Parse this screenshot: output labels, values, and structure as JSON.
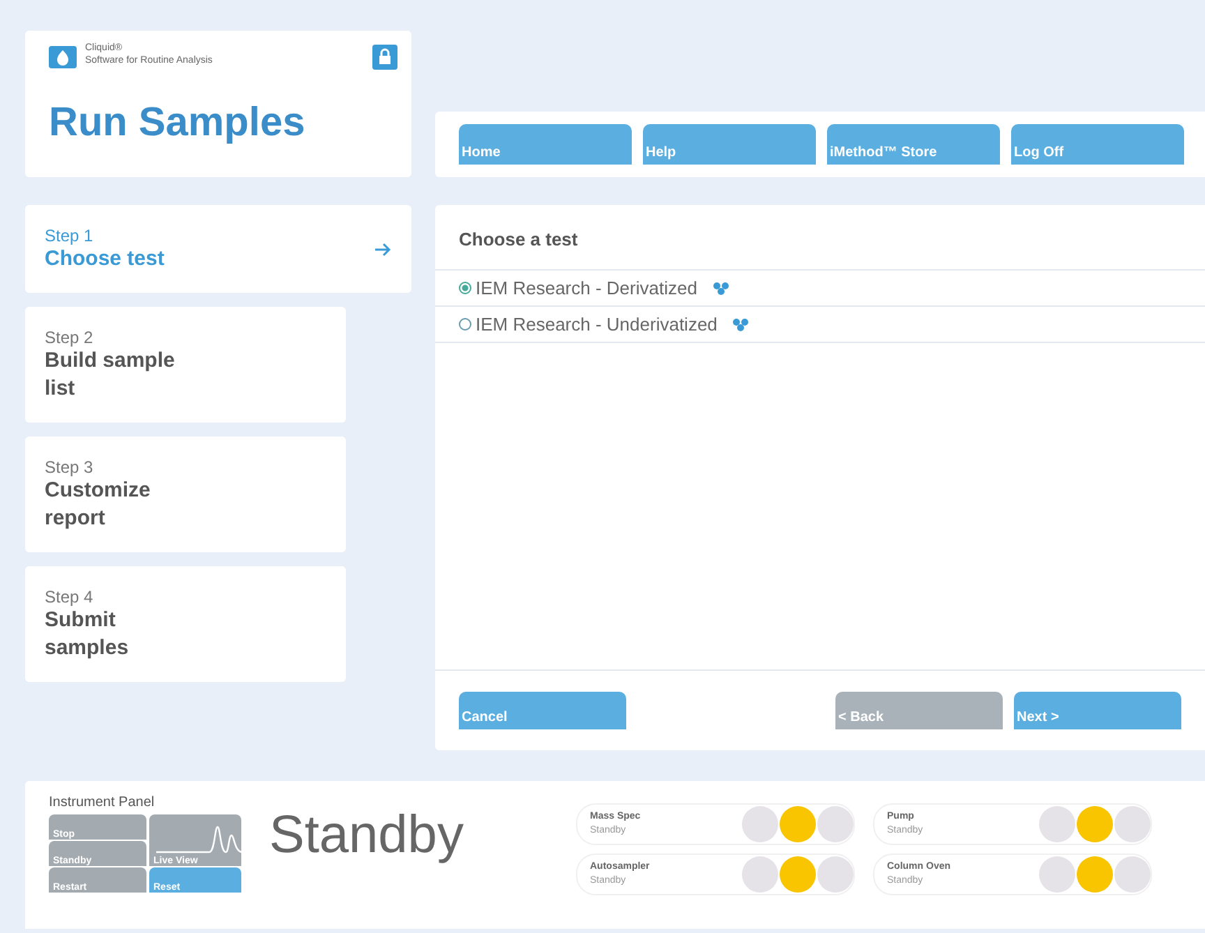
{
  "brand": {
    "name": "Cliquid®",
    "tagline": "Software for Routine Analysis"
  },
  "page_title": "Run Samples",
  "nav": [
    "Home",
    "Help",
    "iMethod™ Store",
    "Log Off"
  ],
  "steps": [
    {
      "step": "Step 1",
      "label": "Choose test",
      "selected": true
    },
    {
      "step": "Step 2",
      "label": "Build sample list",
      "selected": false
    },
    {
      "step": "Step 3",
      "label": "Customize report",
      "selected": false
    },
    {
      "step": "Step 4",
      "label": "Submit samples",
      "selected": false
    }
  ],
  "panel_title": "Choose a test",
  "tests": [
    {
      "label": "IEM Research - Derivatized",
      "selected": true
    },
    {
      "label": "IEM Research - Underivatized",
      "selected": false
    }
  ],
  "footer_buttons": [
    {
      "label": "Cancel",
      "disabled": false
    },
    {
      "label": "< Back",
      "disabled": true
    },
    {
      "label": "Next >",
      "disabled": false
    }
  ],
  "instrument_panel": {
    "title": "Instrument Panel",
    "status": "Standby",
    "controls": [
      {
        "label": "Stop",
        "selected": false
      },
      {
        "label": "Standby",
        "selected": false
      },
      {
        "label": "Restart",
        "selected": false
      },
      {
        "label": "Live View",
        "selected": false
      },
      {
        "label": "Reset",
        "selected": true
      }
    ],
    "instruments": [
      {
        "name": "Mass Spec",
        "status": "Standby",
        "lights": [
          {
            "on": false
          },
          {
            "on": true
          },
          {
            "on": false
          }
        ]
      },
      {
        "name": "Pump",
        "status": "Standby",
        "lights": [
          {
            "on": false
          },
          {
            "on": true
          },
          {
            "on": false
          }
        ]
      },
      {
        "name": "Autosampler",
        "status": "Standby",
        "lights": [
          {
            "on": false
          },
          {
            "on": true
          },
          {
            "on": false
          }
        ]
      },
      {
        "name": "Column Oven",
        "status": "Standby",
        "lights": [
          {
            "on": false
          },
          {
            "on": true
          },
          {
            "on": false
          }
        ]
      }
    ]
  }
}
